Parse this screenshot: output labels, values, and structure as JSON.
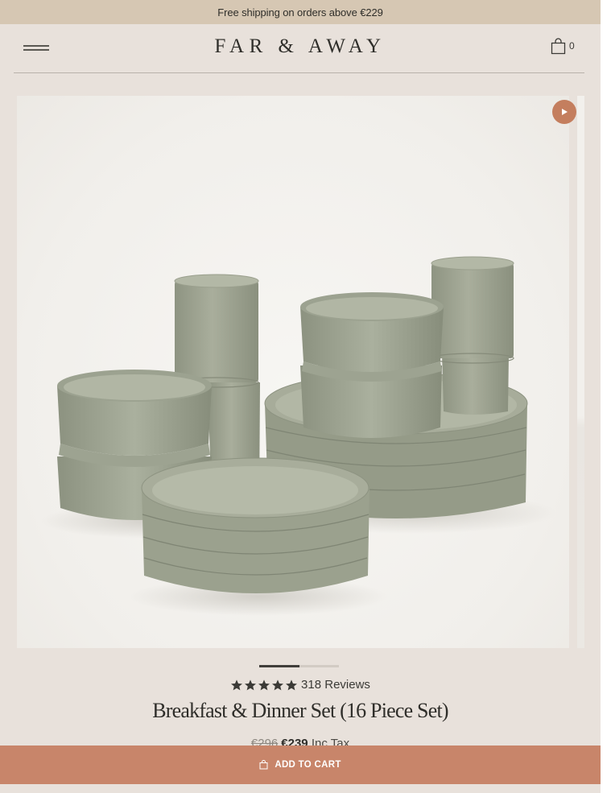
{
  "announcement": {
    "text": "Free shipping on orders above €229"
  },
  "header": {
    "logo": "FAR & AWAY",
    "menu_icon": "hamburger-menu-icon",
    "cart_icon": "shopping-bag-icon",
    "cart_count": "0"
  },
  "gallery": {
    "image_description": "green stoneware dinner set",
    "video_icon": "play-icon",
    "slide_indicator": {
      "active_fraction": 0.5
    }
  },
  "product": {
    "rating": 5,
    "reviews_label": "318 Reviews",
    "title": "Breakfast & Dinner Set (16 Piece Set)",
    "old_price": "€296",
    "price": "€239",
    "tax_label": "Inc Tax"
  },
  "cart_button": {
    "label": "ADD TO CART",
    "icon": "shopping-bag-icon"
  },
  "colors": {
    "announcement_bg": "#d6c7b3",
    "page_bg": "#e8e1db",
    "accent": "#c8856a",
    "dish_green": "#a3a896"
  }
}
